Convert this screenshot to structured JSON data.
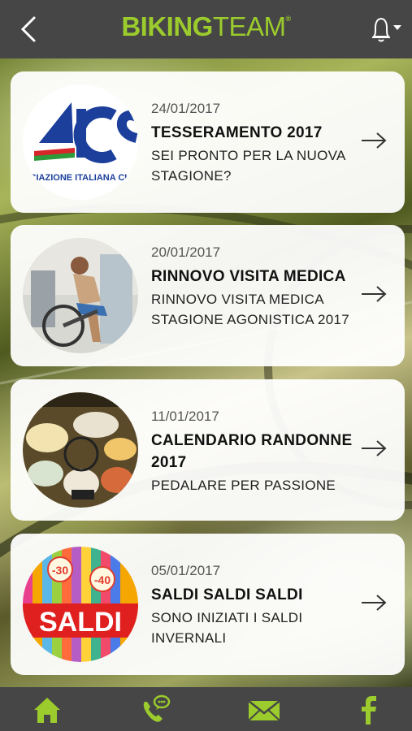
{
  "header": {
    "brand_bold": "BIKING",
    "brand_light": "TEAM",
    "brand_mark": "®",
    "back_icon": "chevron-left-icon",
    "bell_icon": "bell-icon"
  },
  "colors": {
    "brand": "#9bcb2c",
    "bar": "#464646",
    "card": "#ffffff"
  },
  "news": [
    {
      "date": "24/01/2017",
      "title": "TESSERAMENTO 2017",
      "subtitle": "SEI PRONTO PER LA NUOVA STAGIONE?",
      "thumb_text": "OCIAZIONE ITALIANA CULTUR",
      "logo": "AICS"
    },
    {
      "date": "20/01/2017",
      "title": "RINNOVO VISITA MEDICA",
      "subtitle": "RINNOVO VISITA MEDICA STAGIONE AGONISTICA 2017"
    },
    {
      "date": "11/01/2017",
      "title": "CALENDARIO RANDONNE 2017",
      "subtitle": "PEDALARE PER PASSIONE"
    },
    {
      "date": "05/01/2017",
      "title": "SALDI SALDI SALDI",
      "subtitle": "SONO INIZIATI I SALDI INVERNALI",
      "thumb_labels": [
        "-30",
        "-40",
        "SALDI"
      ]
    }
  ],
  "tabs": [
    {
      "name": "home",
      "icon": "home-icon"
    },
    {
      "name": "phone",
      "icon": "phone-chat-icon"
    },
    {
      "name": "mail",
      "icon": "mail-icon"
    },
    {
      "name": "facebook",
      "icon": "facebook-icon"
    }
  ]
}
